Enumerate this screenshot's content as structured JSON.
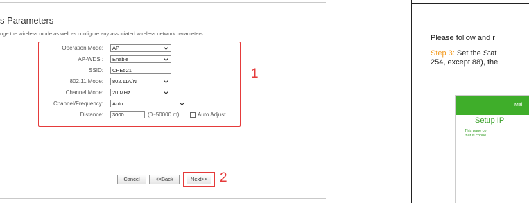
{
  "router_page": {
    "heading": "s Parameters",
    "description": "nge the wireless mode as well as configure any associated wireless network parameters.",
    "form": {
      "operation_mode": {
        "label": "Operation Mode:",
        "value": "AP"
      },
      "ap_wds": {
        "label": "AP-WDS :",
        "value": "Enable"
      },
      "ssid": {
        "label": "SSID:",
        "value": "CPE521"
      },
      "mode_80211": {
        "label": "802.11 Mode:",
        "value": "802.11A/N"
      },
      "channel_mode": {
        "label": "Channel Mode:",
        "value": "20 MHz"
      },
      "channel_frequency": {
        "label": "Channel/Frequency:",
        "value": "Auto"
      },
      "distance": {
        "label": "Distance:",
        "value": "3000",
        "range_hint": "(0~50000 m)",
        "auto_adjust_label": "Auto Adjust",
        "auto_adjust_checked": false
      }
    },
    "buttons": {
      "cancel": "Cancel",
      "back": "<<Back",
      "next": "Next>>"
    },
    "annotations": {
      "box1": "1",
      "box2": "2"
    },
    "colors": {
      "annotation": "#e53b3b"
    }
  },
  "manual_page": {
    "instruction": "Please follow and r",
    "step_label": "Step 3:",
    "step_text": " Set the Stat",
    "step_line2": "254, except 88), the",
    "mini_screenshot": {
      "header_text": "Mai",
      "title": "Setup IP",
      "desc_line1": "This page co",
      "desc_line2": "that is conne"
    },
    "colors": {
      "step": "#f39a1e",
      "green": "#3fae2a"
    }
  }
}
